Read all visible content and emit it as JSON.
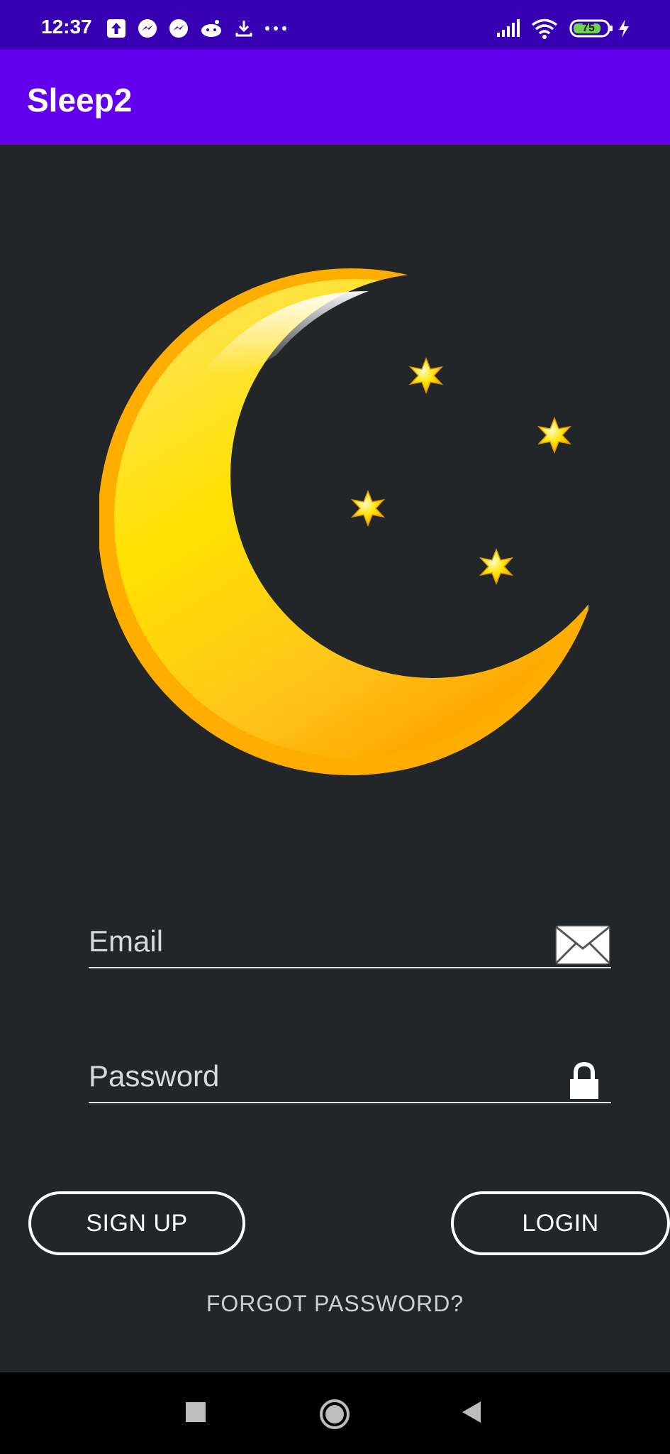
{
  "status_bar": {
    "time": "12:37",
    "left_icons": [
      "upload-arrow-icon",
      "messenger-icon",
      "messenger-icon",
      "reddit-icon",
      "download-icon",
      "more-dots-icon"
    ],
    "right_icons": [
      "signal-icon",
      "wifi-icon",
      "battery-icon",
      "charging-bolt-icon"
    ],
    "battery_level": "75"
  },
  "app_bar": {
    "title": "Sleep2"
  },
  "hero": {
    "icon": "moon-and-stars-icon"
  },
  "form": {
    "email": {
      "placeholder": "Email",
      "value": "",
      "icon": "envelope-icon"
    },
    "password": {
      "placeholder": "Password",
      "value": "",
      "icon": "lock-icon"
    }
  },
  "buttons": {
    "sign_up": "SIGN UP",
    "login": "LOGIN"
  },
  "forgot_password": "FORGOT PASSWORD?",
  "nav_bar": {
    "items": [
      "recents-square-icon",
      "home-circle-icon",
      "back-triangle-icon"
    ]
  },
  "colors": {
    "status_bar": "#3700b3",
    "app_bar": "#6200ee",
    "background": "#232629",
    "moon": "#ffc107",
    "text": "#ffffff"
  }
}
